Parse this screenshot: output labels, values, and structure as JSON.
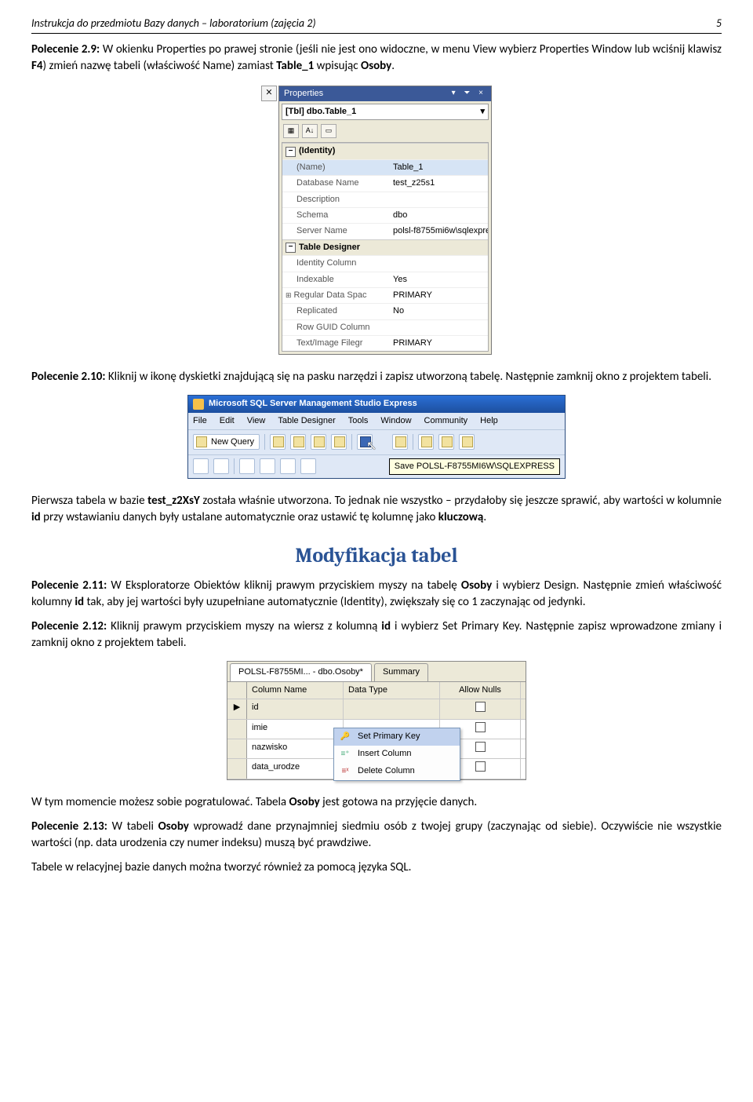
{
  "header": {
    "title": "Instrukcja do przedmiotu Bazy danych – laboratorium (zajęcia 2)",
    "page": "5"
  },
  "p29": {
    "lead": "Polecenie 2.9:",
    "text": " W okienku Properties po prawej stronie (jeśli nie jest ono widoczne, w menu View wybierz Properties Window lub wciśnij klawisz ",
    "key": "F4",
    "text2": ") zmień nazwę tabeli (właściwość Name) zamiast ",
    "tbl": "Table_1",
    "text3": " wpisując ",
    "val": "Osoby",
    "tail": "."
  },
  "propPanel": {
    "title": "Properties",
    "object": "[Tbl] dbo.Table_1",
    "catIdentity": "(Identity)",
    "rowsIdentity": [
      {
        "k": "(Name)",
        "v": "Table_1",
        "sel": true
      },
      {
        "k": "Database Name",
        "v": "test_z25s1"
      },
      {
        "k": "Description",
        "v": ""
      },
      {
        "k": "Schema",
        "v": "dbo"
      },
      {
        "k": "Server Name",
        "v": "polsl-f8755mi6w\\sqlexpres"
      }
    ],
    "catDesigner": "Table Designer",
    "rowsDesigner": [
      {
        "k": "Identity Column",
        "v": ""
      },
      {
        "k": "Indexable",
        "v": "Yes"
      },
      {
        "k": "Regular Data Spac",
        "v": "PRIMARY",
        "plus": true
      },
      {
        "k": "Replicated",
        "v": "No"
      },
      {
        "k": "Row GUID Column",
        "v": ""
      },
      {
        "k": "Text/Image Filegr",
        "v": "PRIMARY"
      }
    ]
  },
  "p210": {
    "lead": "Polecenie 2.10:",
    "text": " Kliknij w ikonę dyskietki znajdującą się na pasku narzędzi i zapisz utworzoną tabelę. Następnie zamknij okno z projektem tabeli."
  },
  "ssms": {
    "title": "Microsoft SQL Server Management Studio Express",
    "menu": [
      "File",
      "Edit",
      "View",
      "Table Designer",
      "Tools",
      "Window",
      "Community",
      "Help"
    ],
    "newQuery": "New Query",
    "tooltip": "Save POLSL-F8755MI6W\\SQLEXPRESS"
  },
  "afterSsms": {
    "p1a": "Pierwsza tabela w bazie ",
    "db": "test_z2XsY",
    "p1b": " została właśnie utworzona. To jednak nie wszystko – przydałoby się jeszcze sprawić, aby wartości w kolumnie ",
    "col": "id",
    "p1c": " przy wstawianiu danych były ustalane automatycznie oraz ustawić tę kolumnę jako ",
    "kw": "kluczową",
    "p1d": "."
  },
  "sectionMod": "Modyfikacja tabel",
  "p211": {
    "lead": "Polecenie 2.11:",
    "text": " W Eksploratorze Obiektów kliknij prawym przyciskiem myszy na tabelę ",
    "t1": "Osoby",
    "text2": " i wybierz Design. Następnie zmień właściwość kolumny ",
    "col": "id",
    "text3": " tak, aby jej wartości były uzupełniane automatycznie (Identity), zwiększały się co 1 zaczynając od jedynki."
  },
  "p212": {
    "lead": "Polecenie 2.12:",
    "text": " Kliknij prawym przyciskiem myszy na wiersz z kolumną ",
    "col": "id",
    "text2": " i wybierz Set Primary Key. Następnie zapisz wprowadzone zmiany i zamknij okno z projektem tabeli."
  },
  "tde": {
    "tab1": "POLSL-F8755MI... - dbo.Osoby*",
    "tab2": "Summary",
    "headers": [
      "Column Name",
      "Data Type",
      "Allow Nulls"
    ],
    "rows": [
      {
        "name": "id",
        "sel": true
      },
      {
        "name": "imie"
      },
      {
        "name": "nazwisko"
      },
      {
        "name": "data_urodze"
      }
    ],
    "ctx": {
      "pk": "Set Primary Key",
      "ins": "Insert Column",
      "del": "Delete Column"
    }
  },
  "afterTde": {
    "a": "W tym momencie możesz sobie pogratulować. Tabela ",
    "b": "Osoby",
    "c": " jest gotowa na przyjęcie danych."
  },
  "p213": {
    "lead": "Polecenie 2.13:",
    "text": " W tabeli ",
    "t": "Osoby",
    "text2": " wprowadź dane przynajmniej siedmiu osób z twojej grupy (zaczynając od siebie). Oczywiście nie wszystkie wartości (np. data urodzenia czy numer indeksu) muszą być prawdziwe."
  },
  "lastPara": "Tabele w relacyjnej bazie danych można tworzyć również za pomocą języka SQL."
}
